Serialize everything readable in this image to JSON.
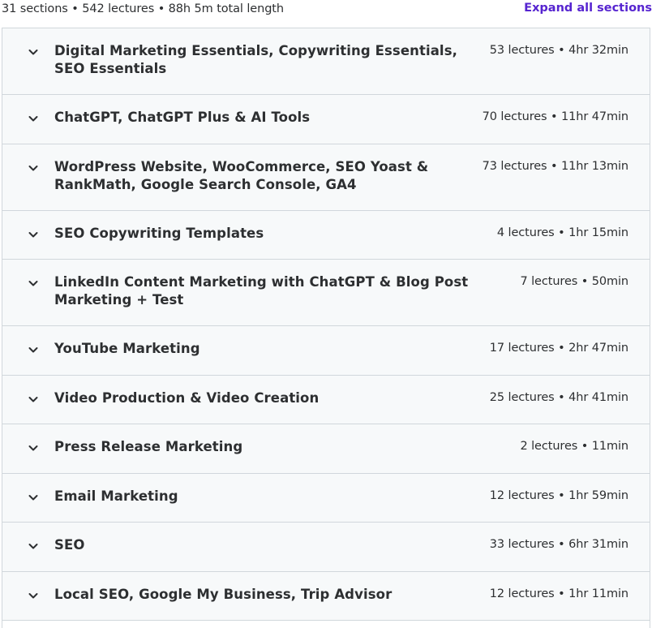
{
  "header": {
    "summary": "31 sections • 542 lectures • 88h 5m total length",
    "expand_all_label": "Expand all sections"
  },
  "colors": {
    "accent": "#5624d0",
    "section_bg": "#f7f9fa",
    "border": "#d1d7dc",
    "text": "#2d2f31"
  },
  "sections": [
    {
      "title": "Digital Marketing Essentials, Copywriting Essentials, SEO Essentials",
      "meta": "53 lectures • 4hr 32min",
      "icon": "chevron-down-icon"
    },
    {
      "title": "ChatGPT, ChatGPT Plus & AI Tools",
      "meta": "70 lectures • 11hr 47min",
      "icon": "chevron-down-icon"
    },
    {
      "title": "WordPress Website, WooCommerce, SEO Yoast & RankMath, Google Search Console, GA4",
      "meta": "73 lectures • 11hr 13min",
      "icon": "chevron-down-icon"
    },
    {
      "title": "SEO Copywriting Templates",
      "meta": "4 lectures • 1hr 15min",
      "icon": "chevron-down-icon"
    },
    {
      "title": "LinkedIn Content Marketing with ChatGPT & Blog Post Marketing + Test",
      "meta": "7 lectures • 50min",
      "icon": "chevron-down-icon"
    },
    {
      "title": "YouTube Marketing",
      "meta": "17 lectures • 2hr 47min",
      "icon": "chevron-down-icon"
    },
    {
      "title": "Video Production & Video Creation",
      "meta": "25 lectures • 4hr 41min",
      "icon": "chevron-down-icon"
    },
    {
      "title": "Press Release Marketing",
      "meta": "2 lectures • 11min",
      "icon": "chevron-down-icon"
    },
    {
      "title": "Email Marketing",
      "meta": "12 lectures • 1hr 59min",
      "icon": "chevron-down-icon"
    },
    {
      "title": "SEO",
      "meta": "33 lectures • 6hr 31min",
      "icon": "chevron-down-icon"
    },
    {
      "title": "Local SEO, Google My Business, Trip Advisor",
      "meta": "12 lectures • 1hr 11min",
      "icon": "chevron-down-icon"
    }
  ]
}
